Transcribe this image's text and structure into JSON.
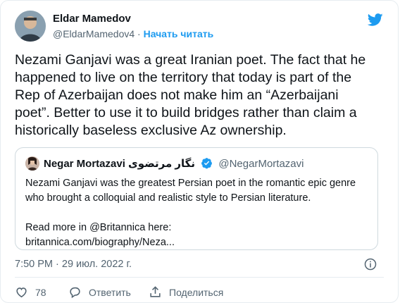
{
  "author": {
    "name": "Eldar Mamedov",
    "handle": "@EldarMamedov4",
    "separator": "·",
    "follow_label": "Начать читать"
  },
  "tweet": {
    "text": "Nezami Ganjavi was a great Iranian poet. The fact that he\nhappened to live on the territory that today is part of the\nRep of Azerbaijan does not make him an “Azerbaijani\npoet”. Better to use it to build bridges rather than claim a\nhistorically baseless exclusive Az ownership."
  },
  "quoted": {
    "name": "Negar Mortazavi",
    "name_native": "نگار مرتضوی",
    "handle": "@NegarMortazavi",
    "line1": "Nezami Ganjavi was the greatest Persian poet in the romantic epic genre",
    "line2": "who brought a colloquial and realistic style to Persian literature.",
    "line3": "Read more in @Britannica here:",
    "line4": "britannica.com/biography/Neza..."
  },
  "meta": {
    "timestamp": "7:50 PM · 29 июл. 2022 г."
  },
  "actions": {
    "like_count": "78",
    "reply_label": "Ответить",
    "share_label": "Поделиться"
  },
  "colors": {
    "accent": "#1d9bf0",
    "like": "#f91880",
    "muted": "#536471"
  },
  "icons": [
    "twitter-bird-icon",
    "verified-badge-icon",
    "info-icon",
    "heart-icon",
    "reply-icon",
    "share-icon"
  ]
}
